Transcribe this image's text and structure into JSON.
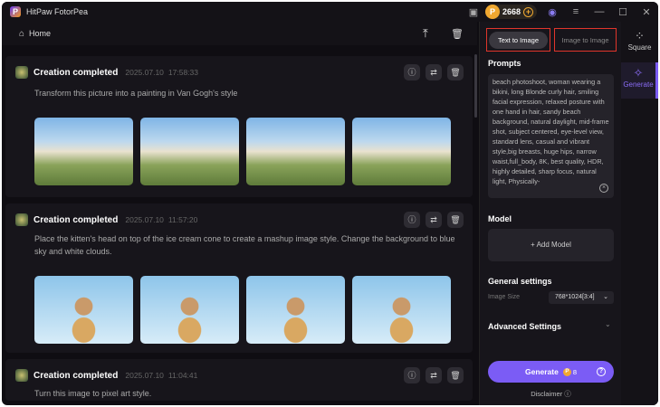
{
  "app": {
    "title": "HitPaw FotorPea",
    "credits": "2668"
  },
  "header": {
    "home_label": "Home"
  },
  "cards": [
    {
      "title": "Creation completed",
      "date": "2025.07.10",
      "time": "17:58:33",
      "text": "Transform this picture into a painting in Van Gogh's style"
    },
    {
      "title": "Creation completed",
      "date": "2025.07.10",
      "time": "11:57:20",
      "text": "Place the kitten's head on top of the ice cream cone to create a mashup image style. Change the background to blue sky and white clouds."
    },
    {
      "title": "Creation completed",
      "date": "2025.07.10",
      "time": "11:04:41",
      "text": "Turn this image to pixel art style."
    }
  ],
  "panel": {
    "tabs": [
      "Text to Image",
      "Image to Image"
    ],
    "prompts_label": "Prompts",
    "prompt_text": "beach photoshoot, woman wearing a bikini, long Blonde curly hair, smiling facial expression, relaxed posture with one hand in hair, sandy beach background, natural daylight, mid-frame shot, subject centered, eye-level view, standard lens, casual and vibrant style,big breasts, huge hips, narrow waist,full_body, 8K, best quality, HDR, highly detailed, sharp focus, natural light, Physically-",
    "model_label": "Model",
    "add_model": "+ Add Model",
    "general_label": "General settings",
    "image_size_label": "Image Size",
    "image_size_value": "768*1024[3:4]",
    "advanced_label": "Advanced Settings",
    "generate_label": "Generate",
    "generate_cost": "8",
    "disclaimer": "Disclaimer"
  },
  "sidenav": [
    {
      "label": "Square",
      "icon": "grid-icon"
    },
    {
      "label": "Generate",
      "icon": "sparkle-icon"
    }
  ],
  "colors": {
    "accent": "#7b5cf5",
    "highlight": "#e0352b",
    "coin": "#f0a830"
  }
}
